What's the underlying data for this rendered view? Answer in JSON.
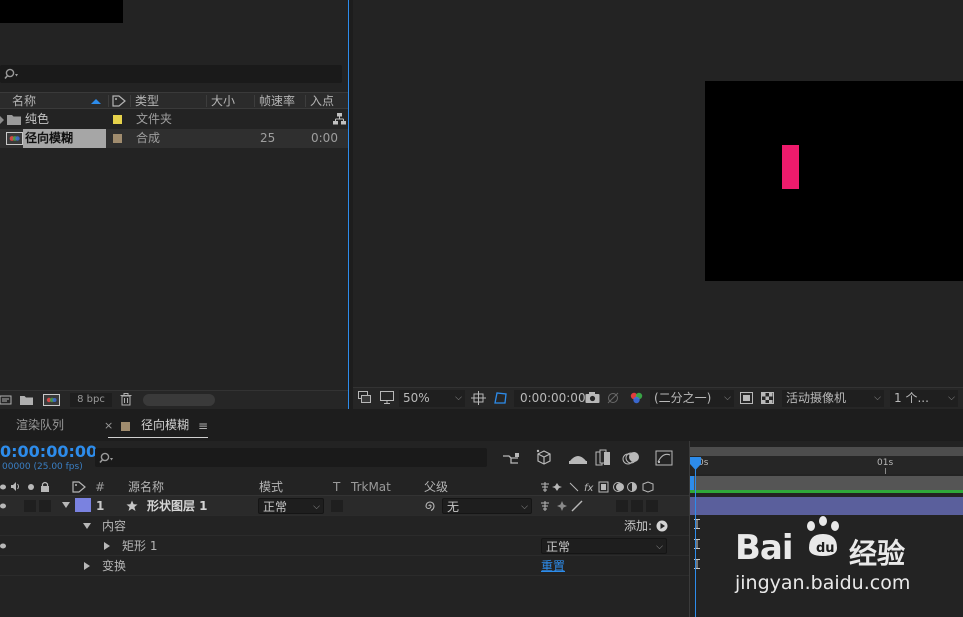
{
  "project": {
    "search_placeholder": "",
    "columns": [
      "名称",
      "类型",
      "大小",
      "帧速率",
      "入点"
    ],
    "items": [
      {
        "name": "纯色",
        "type": "文件夹",
        "rate": "",
        "in": "",
        "label_color": "#e6d24b",
        "kind": "folder"
      },
      {
        "name": "径向模糊",
        "type": "合成",
        "rate": "25",
        "in": "0:00",
        "label_color": "#a08c6e",
        "kind": "composition"
      }
    ],
    "bpc": "8 bpc"
  },
  "viewer": {
    "zoom": "50%",
    "timecode": "0:00:00:00",
    "resolution": "(二分之一)",
    "camera": "活动摄像机",
    "views": "1 个...",
    "layer_color": "#ee1b6c"
  },
  "tabs": {
    "render_queue": "渲染队列",
    "comp_tab": "径向模糊",
    "close": "×",
    "menu": "≡"
  },
  "timeline": {
    "timecode": "0:00:00:00",
    "fps": "00000 (25.00 fps)",
    "search_placeholder": "",
    "columns": {
      "num": "#",
      "source": "源名称",
      "mode": "模式",
      "t": "T",
      "trkmat": "TrkMat",
      "parent": "父级"
    },
    "layer": {
      "index": "1",
      "name": "形状图层 1",
      "mode": "正常",
      "parent": "无",
      "label_color": "#7a82e0"
    },
    "contents_label": "内容",
    "add_label": "添加:",
    "rect_label": "矩形 1",
    "rect_mode": "正常",
    "transform_label": "变换",
    "reset_label": "重置",
    "ruler": {
      "start": "0s",
      "mark": "01s"
    }
  },
  "watermark": {
    "brand": "Bai",
    "brand2": "du",
    "suffix": "经验",
    "url": "jingyan.baidu.com"
  }
}
